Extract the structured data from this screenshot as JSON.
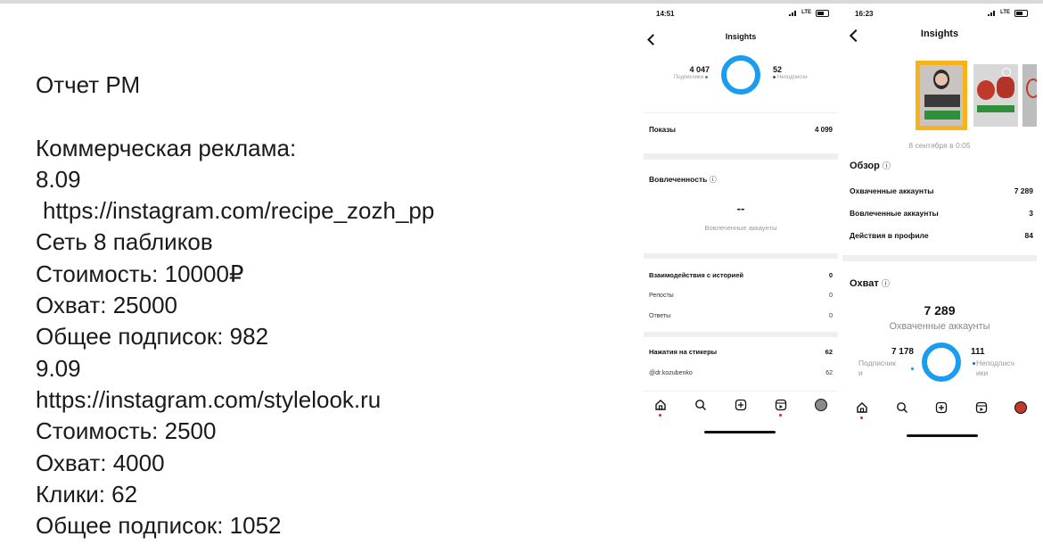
{
  "report": {
    "title": "Отчет РМ",
    "section": "Коммерческая реклама:",
    "campaign1": {
      "date": "8.09",
      "url": "https://instagram.com/recipe_zozh_pp",
      "network": "Сеть 8 пабликов",
      "cost": "Стоимость: 10000₽",
      "reach": "Охват: 25000",
      "total_subs": "Общее подписок: 982"
    },
    "campaign2": {
      "date": "9.09",
      "url": "https://instagram.com/stylelook.ru",
      "cost": "Стоимость: 2500",
      "reach": "Охват: 4000",
      "clicks": "Клики: 62",
      "total_subs": "Общее подписок: 1052"
    }
  },
  "phone1": {
    "status": {
      "time": "14:51",
      "network": "LTE"
    },
    "title": "Insights",
    "followers_value": "4 047",
    "followers_label": "Подписчики",
    "nonfollowers_value": "52",
    "nonfollowers_label": "Неподписчи",
    "impressions_label": "Показы",
    "impressions_value": "4 099",
    "engagement_title": "Вовлеченность",
    "engaged_value": "--",
    "engaged_label": "Вовлеченные аккаунты",
    "story_interactions_label": "Взаимодействия с историей",
    "story_interactions_value": "0",
    "shares_label": "Репосты",
    "shares_value": "0",
    "replies_label": "Ответы",
    "replies_value": "0",
    "sticker_taps_label": "Нажатия на стикеры",
    "sticker_taps_value": "62",
    "sticker_account": "@dr.kozubenko",
    "sticker_account_value": "62"
  },
  "phone2": {
    "status": {
      "time": "16:23",
      "network": "LTE"
    },
    "title": "Insights",
    "date": "8 сентября в 0:05",
    "overview_title": "Обзор",
    "reached_label": "Охваченные аккаунты",
    "reached_value": "7 289",
    "engaged_label": "Вовлеченные аккаунты",
    "engaged_value": "3",
    "profile_actions_label": "Действия в профиле",
    "profile_actions_value": "84",
    "reach_title": "Охват",
    "reach_big_value": "7 289",
    "reach_big_label": "Охваченные аккаунты",
    "followers_value": "7 178",
    "followers_label_1": "Подписчик",
    "followers_label_2": "и",
    "nonfollowers_value": "111",
    "nonfollowers_label_1": "Неподписч",
    "nonfollowers_label_2": "ики"
  },
  "icons": [
    "home-icon",
    "search-icon",
    "create-icon",
    "reels-icon",
    "profile-avatar"
  ],
  "colors": {
    "accent": "#1a9cf0",
    "notification": "#e02828",
    "divider": "#efefef"
  }
}
